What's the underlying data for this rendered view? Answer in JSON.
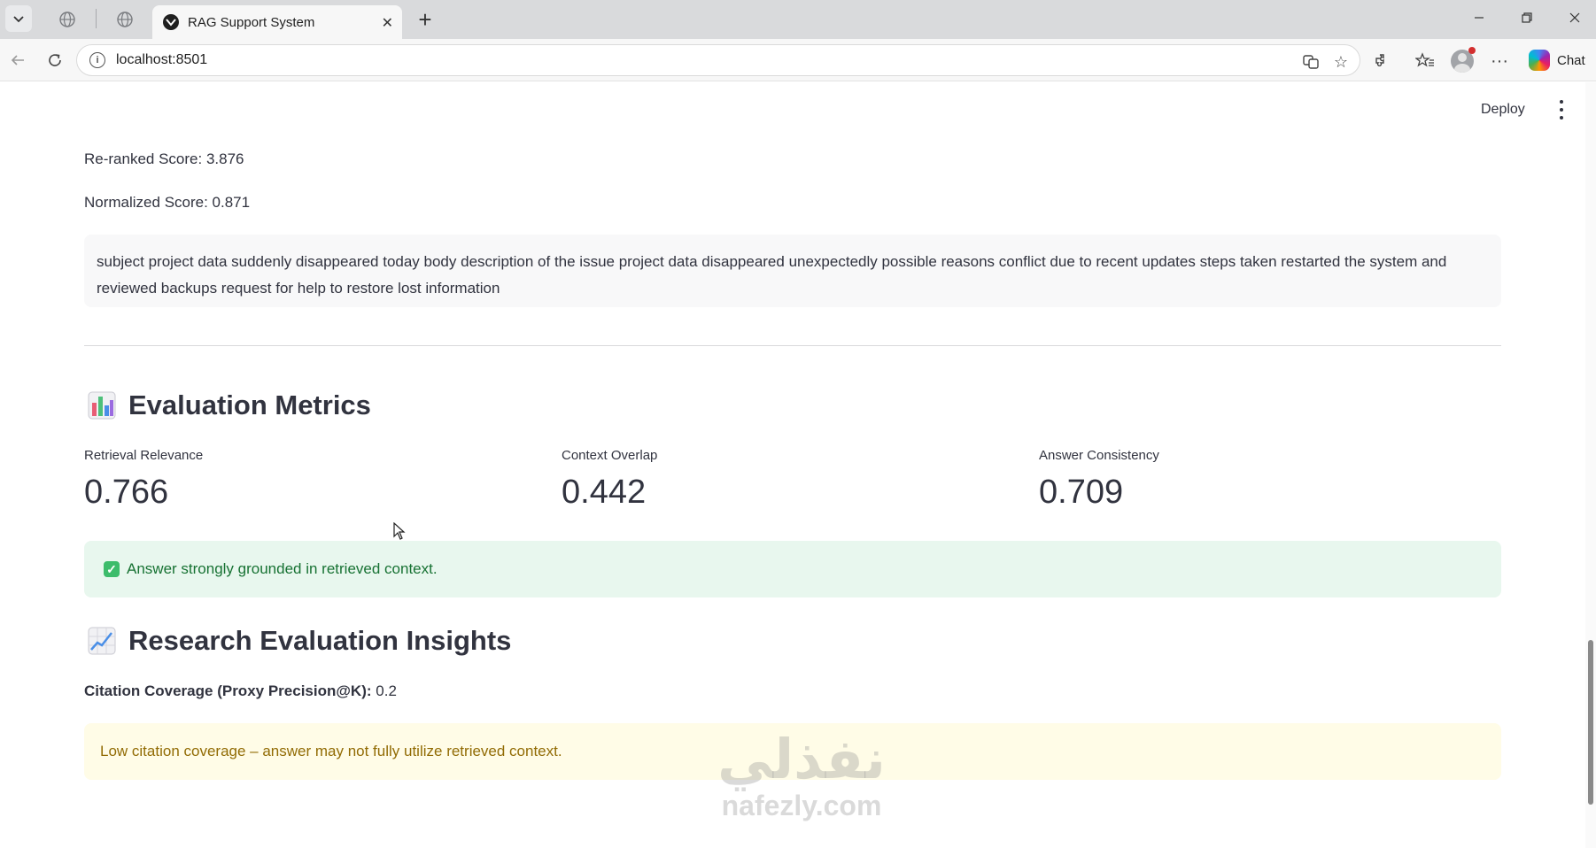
{
  "browser": {
    "tab_title": "RAG Support System",
    "url": "localhost:8501",
    "chat_label": "Chat"
  },
  "app": {
    "deploy_label": "Deploy",
    "reranked_score": "Re-ranked Score: 3.876",
    "normalized_score": "Normalized Score: 0.871",
    "document_text": "subject project data suddenly disappeared today body description of the issue project data disappeared unexpectedly possible reasons conflict due to recent updates steps taken restarted the system and reviewed backups request for help to restore lost information",
    "evaluation": {
      "heading": "Evaluation Metrics",
      "metrics": [
        {
          "label": "Retrieval Relevance",
          "value": "0.766"
        },
        {
          "label": "Context Overlap",
          "value": "0.442"
        },
        {
          "label": "Answer Consistency",
          "value": "0.709"
        }
      ],
      "success_message": "Answer strongly grounded in retrieved context."
    },
    "research": {
      "heading": "Research Evaluation Insights",
      "citation_label": "Citation Coverage (Proxy Precision@K):",
      "citation_value": "0.2",
      "warning_message": "Low citation coverage – answer may not fully utilize retrieved context."
    }
  },
  "watermark": {
    "arabic": "نفذلي",
    "latin": "nafezly.com"
  }
}
